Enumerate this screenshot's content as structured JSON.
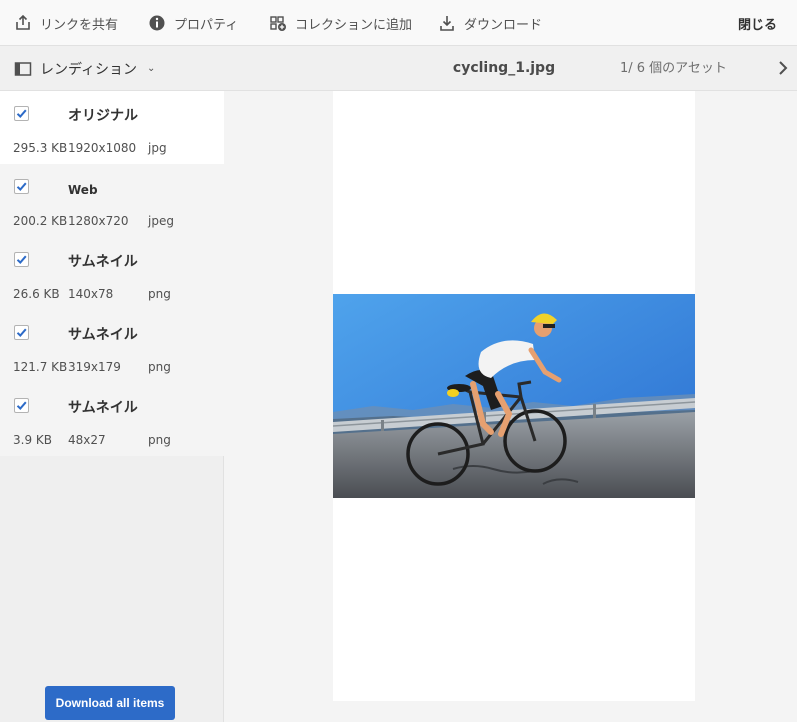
{
  "toolbar": {
    "share_label": "リンクを共有",
    "properties_label": "プロパティ",
    "add_collection_label": "コレクションに追加",
    "download_label": "ダウンロード",
    "close_label": "閉じる"
  },
  "subheader": {
    "renditions_label": "レンディション",
    "filename": "cycling_1.jpg",
    "counter": "1/ 6 個のアセット"
  },
  "renditions": [
    {
      "name": "オリジナル",
      "size": "295.3 KB",
      "dims": "1920x1080",
      "type": "jpg",
      "checked": true,
      "selected": true
    },
    {
      "name": "Web",
      "size": "200.2 KB",
      "dims": "1280x720",
      "type": "jpeg",
      "checked": true,
      "selected": false
    },
    {
      "name": "サムネイル",
      "size": "26.6 KB",
      "dims": "140x78",
      "type": "png",
      "checked": true,
      "selected": false
    },
    {
      "name": "サムネイル",
      "size": "121.7 KB",
      "dims": "319x179",
      "type": "png",
      "checked": true,
      "selected": false
    },
    {
      "name": "サムネイル",
      "size": "3.9 KB",
      "dims": "48x27",
      "type": "png",
      "checked": true,
      "selected": false
    }
  ],
  "download_all_label": "Download all items",
  "icons": {
    "share": "share-icon",
    "properties": "info-icon",
    "collection": "add-collection-icon",
    "download": "download-icon",
    "renditions": "panel-icon",
    "next": "chevron-right-icon"
  },
  "colors": {
    "accent": "#2d6bc8",
    "checkbox": "#2d6bc8"
  }
}
